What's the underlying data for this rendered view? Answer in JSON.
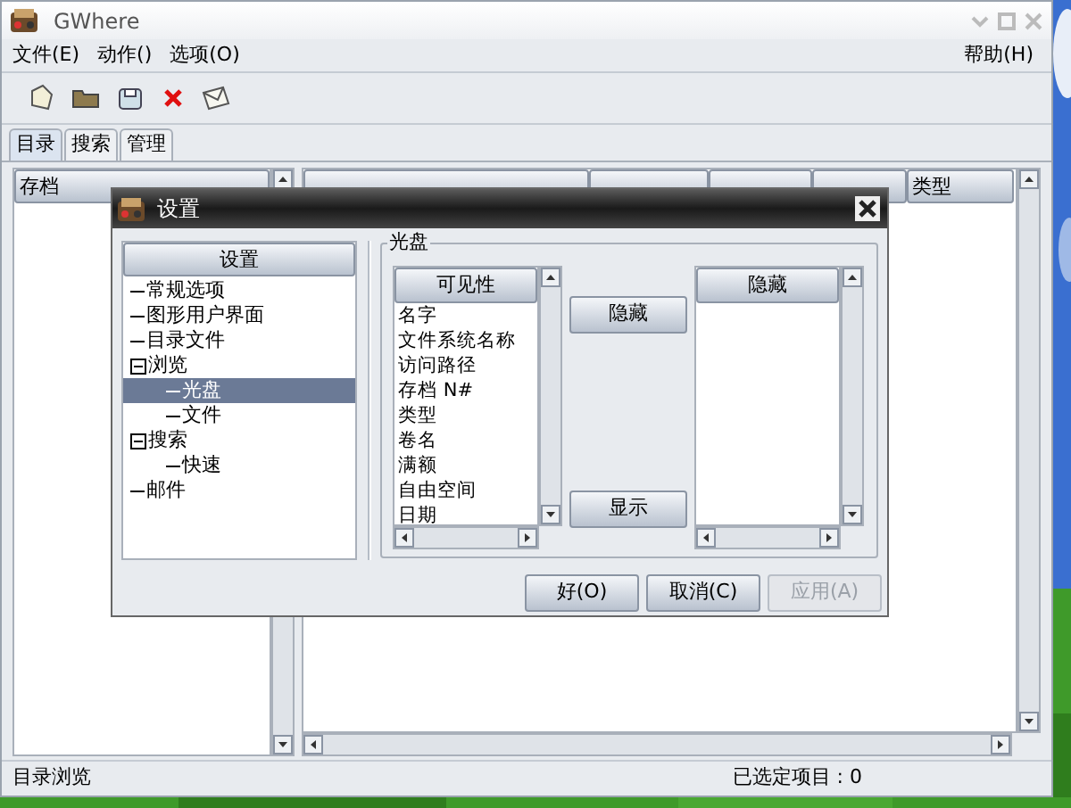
{
  "window": {
    "title": "GWhere"
  },
  "menu": [
    {
      "label": "文件(E)"
    },
    {
      "label": "动作()"
    },
    {
      "label": "选项(O)"
    }
  ],
  "help_menu": {
    "label": "帮助(H)"
  },
  "tabs": [
    {
      "label": "目录",
      "selected": true
    },
    {
      "label": "搜索",
      "selected": false
    },
    {
      "label": "管理",
      "selected": false
    }
  ],
  "left_pane": {
    "header": "存档"
  },
  "table": {
    "columns": [
      "类型"
    ]
  },
  "status_bar": {
    "left": "目录浏览",
    "right": "已选定项目 : 0"
  },
  "dialog": {
    "title": "设置",
    "tree_header": "设置",
    "tree": [
      {
        "label": "常规选项",
        "selected": false
      },
      {
        "label": "图形用户界面",
        "selected": false
      },
      {
        "label": "目录文件",
        "selected": false
      },
      {
        "label": "浏览",
        "selected": false,
        "expanded": true,
        "children": [
          {
            "label": "光盘",
            "selected": true
          },
          {
            "label": "文件",
            "selected": false
          }
        ]
      },
      {
        "label": "搜索",
        "selected": false,
        "expanded": true,
        "children": [
          {
            "label": "快速",
            "selected": false
          }
        ]
      },
      {
        "label": "邮件",
        "selected": false
      }
    ],
    "frame_title": "光盘",
    "visible_list": {
      "header": "可见性",
      "items": [
        "名字",
        "文件系统名称",
        "访问路径",
        "存档 N#",
        "类型",
        "卷名",
        "满额",
        "自由空间",
        "日期"
      ]
    },
    "hide_button": "隐藏",
    "show_button": "显示",
    "hidden_list": {
      "header": "隐藏"
    },
    "buttons": [
      {
        "label": "好(O)",
        "disabled": false
      },
      {
        "label": "取消(C)",
        "disabled": false
      },
      {
        "label": "应用(A)",
        "disabled": true
      }
    ]
  }
}
